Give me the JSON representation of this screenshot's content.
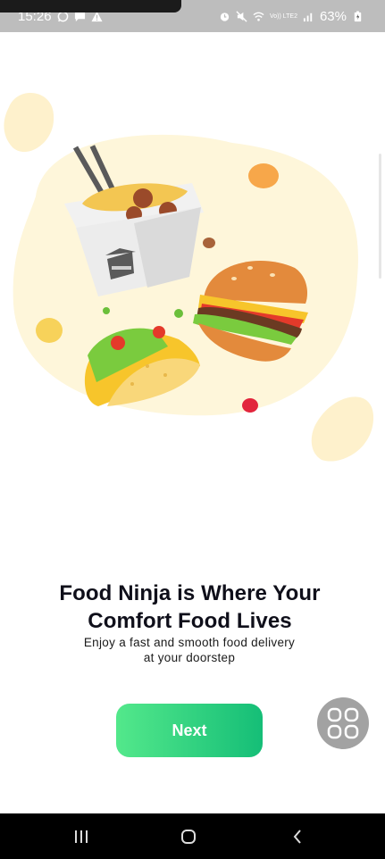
{
  "status_bar": {
    "time": "15:26",
    "battery": "63%",
    "network_label": "Vo)) LTE2"
  },
  "onboarding": {
    "title_line1": "Food Ninja is Where Your",
    "title_line2": "Comfort Food Lives",
    "subtitle_line1": "Enjoy a fast and smooth food delivery",
    "subtitle_line2": "at your doorstep",
    "next_label": "Next"
  },
  "colors": {
    "accent_start": "#53E88B",
    "accent_end": "#15BE77",
    "blob": "#FEF6DA"
  },
  "icons": {
    "status_left": [
      "whatsapp-icon",
      "chat-icon",
      "warning-icon"
    ],
    "status_right": [
      "alarm-icon",
      "mute-icon",
      "wifi-icon",
      "signal-icon",
      "battery-icon"
    ],
    "floating": "grid-apps-icon",
    "nav": [
      "recent-apps-icon",
      "home-icon",
      "back-icon"
    ]
  }
}
